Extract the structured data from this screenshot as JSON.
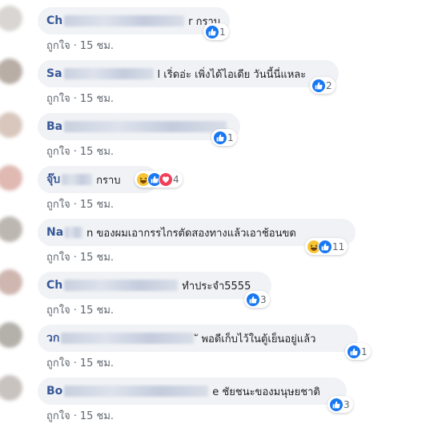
{
  "comments": [
    {
      "name": "Ch",
      "redact_w": 176,
      "text": "r กราบ",
      "like_label": "ถูกใจ",
      "sep": "·",
      "time": "15 ชม.",
      "reactions": [
        "like"
      ],
      "count": "1",
      "avatar_color": "#d8d5d2"
    },
    {
      "name": "Sa",
      "redact_w": 112,
      "text": "l เริ่ดอ่ะ เพิ่งได้ไอเดีย วันนี้นี่แหละ",
      "like_label": "ถูกใจ",
      "sep": "·",
      "time": "15 ชม.",
      "reactions": [
        "like"
      ],
      "count": "2",
      "avatar_color": "#b8aea6"
    },
    {
      "name": "Ba",
      "redact_w": 214,
      "text": "",
      "like_label": "ถูกใจ",
      "sep": "·",
      "time": "15 ชม.",
      "reactions": [
        "like"
      ],
      "count": "1",
      "avatar_color": "#d9c7bd"
    },
    {
      "name": "จุ๊บ",
      "redact_w": 38,
      "text": "กราบ",
      "like_label": "ถูกใจ",
      "sep": "·",
      "time": "15 ชม.",
      "reactions": [
        "haha",
        "like",
        "love"
      ],
      "count": "4",
      "avatar_color": "#e0b9b2"
    },
    {
      "name": "Na",
      "redact_w": 22,
      "text": "n ของผมเอากรรไกรตัดสองทางแล้วเอาช้อนขด",
      "like_label": "ถูกใจ",
      "sep": "·",
      "time": "15 ชม.",
      "reactions": [
        "haha",
        "like"
      ],
      "count": "11",
      "avatar_color": "#bdb7b1"
    },
    {
      "name": "Ch",
      "redact_w": 142,
      "text": "ทำประจำ5555",
      "like_label": "ถูกใจ",
      "sep": "·",
      "time": "15 ชม.",
      "reactions": [
        "like"
      ],
      "count": "3",
      "avatar_color": "#cfb7b0"
    },
    {
      "name": "วก",
      "redact_w": 166,
      "text": "ั พอดีเก็บไว้ในตู้เย็นอยู่แล้ว",
      "like_label": "ถูกใจ",
      "sep": "·",
      "time": "15 ชม.",
      "reactions": [
        "like"
      ],
      "count": "1",
      "avatar_color": "#b4b1ab"
    },
    {
      "name": "Bo",
      "redact_w": 180,
      "text": "e ชัยชนะของมนุษยชาติ",
      "like_label": "ถูกใจ",
      "sep": "·",
      "time": "15 ชม.",
      "reactions": [
        "like"
      ],
      "count": "3",
      "avatar_color": "#c9c3bf"
    }
  ],
  "colors": {
    "bubble_bg": "#f0f2f5",
    "name": "#385898",
    "text": "#1c1e21",
    "meta": "#606770",
    "like": "#1877f2",
    "haha": "#f7c534",
    "love": "#f33e58"
  },
  "icons": {
    "like": "thumbs-up-icon",
    "haha": "laughing-face-icon",
    "love": "heart-icon"
  }
}
